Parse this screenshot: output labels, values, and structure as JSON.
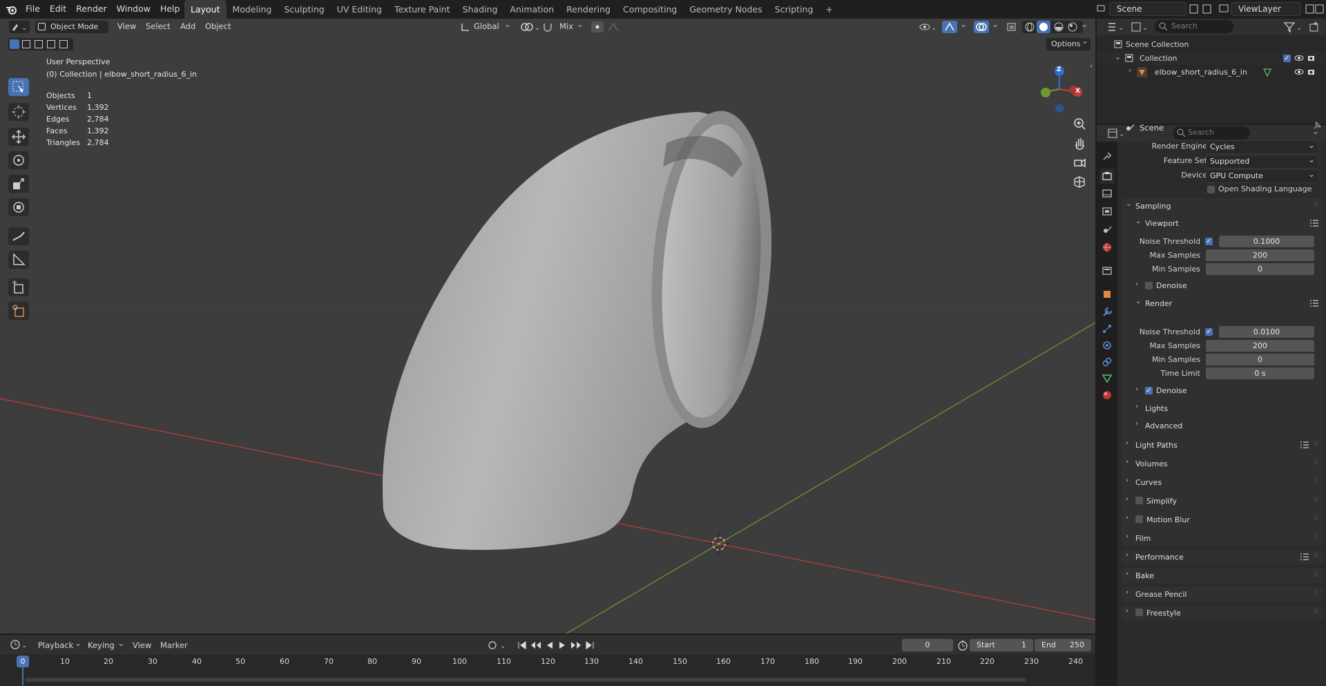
{
  "app_menu": [
    "File",
    "Edit",
    "Render",
    "Window",
    "Help"
  ],
  "workspaces": [
    "Layout",
    "Modeling",
    "Sculpting",
    "UV Editing",
    "Texture Paint",
    "Shading",
    "Animation",
    "Rendering",
    "Compositing",
    "Geometry Nodes",
    "Scripting"
  ],
  "active_workspace": "Layout",
  "scene_field": "Scene",
  "viewlayer_field": "ViewLayer",
  "header": {
    "mode": "Object Mode",
    "menus": [
      "View",
      "Select",
      "Add",
      "Object"
    ],
    "transform": "Global",
    "snap_mode": "Mix",
    "options": "Options"
  },
  "viewport": {
    "perspective": "User Perspective",
    "collection": "(0) Collection | elbow_short_radius_6_in",
    "stats": [
      {
        "label": "Objects",
        "value": "1"
      },
      {
        "label": "Vertices",
        "value": "1,392"
      },
      {
        "label": "Edges",
        "value": "2,784"
      },
      {
        "label": "Faces",
        "value": "1,392"
      },
      {
        "label": "Triangles",
        "value": "2,784"
      }
    ],
    "gizmo": {
      "z": "Z",
      "x": "X"
    }
  },
  "outliner": {
    "search_placeholder": "Search",
    "scene_collection": "Scene Collection",
    "collection": "Collection",
    "object": "elbow_short_radius_6_in"
  },
  "properties": {
    "search_placeholder": "Search",
    "context": "Scene",
    "render_engine_label": "Render Engine",
    "render_engine": "Cycles",
    "feature_set_label": "Feature Set",
    "feature_set": "Supported",
    "device_label": "Device",
    "device": "GPU Compute",
    "osl_label": "Open Shading Language",
    "sampling": "Sampling",
    "viewport_sub": "Viewport",
    "vp_noise_label": "Noise Threshold",
    "vp_noise": "0.1000",
    "vp_max_label": "Max Samples",
    "vp_max": "200",
    "vp_min_label": "Min Samples",
    "vp_min": "0",
    "vp_denoise": "Denoise",
    "render_sub": "Render",
    "r_noise_label": "Noise Threshold",
    "r_noise": "0.0100",
    "r_max_label": "Max Samples",
    "r_max": "200",
    "r_min_label": "Min Samples",
    "r_min": "0",
    "r_time_label": "Time Limit",
    "r_time": "0 s",
    "r_denoise": "Denoise",
    "lights": "Lights",
    "advanced": "Advanced",
    "panels": [
      "Light Paths",
      "Volumes",
      "Curves",
      "Simplify",
      "Motion Blur",
      "Film",
      "Performance",
      "Bake",
      "Grease Pencil",
      "Freestyle"
    ]
  },
  "timeline": {
    "menus": [
      "Playback",
      "Keying",
      "View",
      "Marker"
    ],
    "current_frame": "0",
    "start_label": "Start",
    "start": "1",
    "end_label": "End",
    "end": "250",
    "ruler": [
      "0",
      "10",
      "20",
      "30",
      "40",
      "50",
      "60",
      "70",
      "80",
      "90",
      "100",
      "110",
      "120",
      "130",
      "140",
      "150",
      "160",
      "170",
      "180",
      "190",
      "200",
      "210",
      "220",
      "230",
      "240"
    ]
  },
  "colors": {
    "accent": "#4772b3",
    "x_axis": "#c23b3b",
    "y_axis": "#6f9a2e",
    "z_axis": "#2f6fd1",
    "viewport_bg": "#3d3d3d"
  }
}
